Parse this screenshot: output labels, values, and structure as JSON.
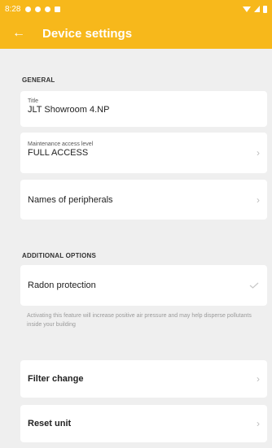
{
  "status_bar": {
    "time": "8:28"
  },
  "app_bar": {
    "back_icon": "arrow-left-icon",
    "title": "Device settings"
  },
  "general": {
    "heading": "GENERAL",
    "title_field": {
      "label": "Title",
      "value": "JLT Showroom 4.NP"
    },
    "maintenance_field": {
      "label": "Maintenance access level",
      "value": "FULL ACCESS"
    },
    "peripherals": {
      "label": "Names of peripherals"
    }
  },
  "additional": {
    "heading": "ADDITIONAL OPTIONS",
    "radon": {
      "label": "Radon protection"
    },
    "radon_note": "Activating this feature will increase positive air pressure and may help disperse pollutants inside your building",
    "filter_change": {
      "label": "Filter change"
    },
    "reset_unit": {
      "label": "Reset unit"
    }
  },
  "colors": {
    "accent": "#f7b81b",
    "background": "#efefef"
  }
}
